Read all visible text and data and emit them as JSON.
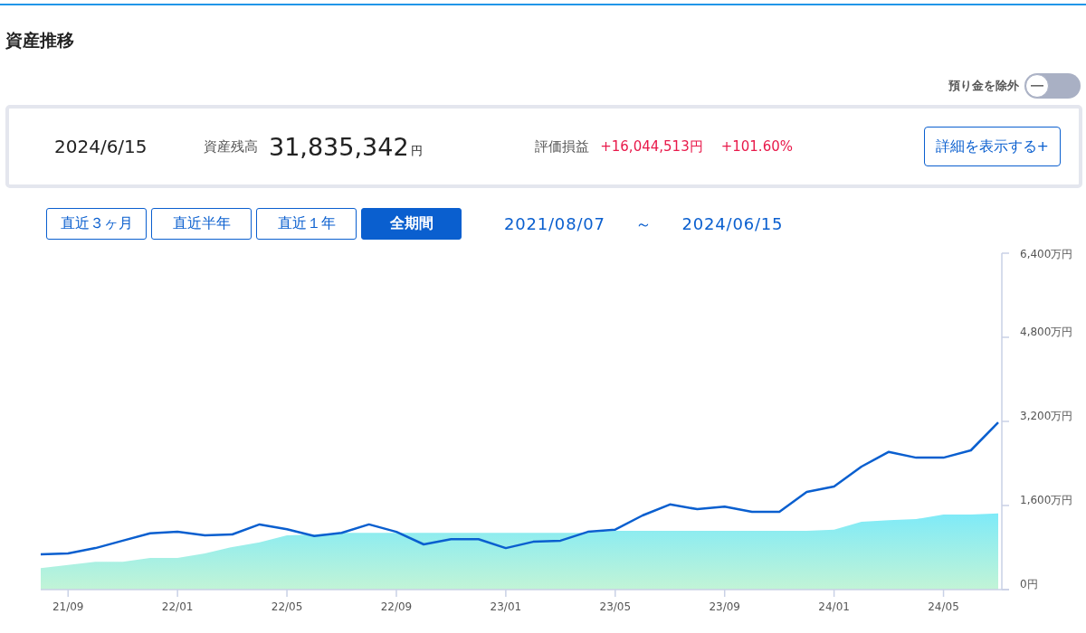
{
  "title": "資産推移",
  "toggle": {
    "label": "預り金を除外",
    "on": false
  },
  "summary": {
    "date": "2024/6/15",
    "balance_label": "資産残高",
    "balance": "31,835,342",
    "balance_unit": "円",
    "profit_label": "評価損益",
    "profit": "+16,044,513円",
    "profit_rate": "+101.60%",
    "detail_button": "詳細を表示する+"
  },
  "periods": [
    {
      "label": "直近３ヶ月",
      "selected": false
    },
    {
      "label": "直近半年",
      "selected": false
    },
    {
      "label": "直近１年",
      "selected": false
    },
    {
      "label": "全期間",
      "selected": true
    }
  ],
  "range": {
    "start": "2021/08/07",
    "separator": "～",
    "end": "2024/06/15"
  },
  "chart": {
    "chart_data": {
      "type": "line",
      "categories": [
        null,
        "21/09",
        null,
        null,
        null,
        "22/01",
        null,
        null,
        null,
        "22/05",
        null,
        null,
        null,
        "22/09",
        null,
        null,
        null,
        "23/01",
        null,
        null,
        null,
        "23/05",
        null,
        null,
        null,
        "23/09",
        null,
        null,
        null,
        "24/01",
        null,
        null,
        null,
        "24/05",
        null,
        null
      ],
      "series": [
        {
          "type": "area",
          "color": "#7eeaf8",
          "values": [
            410,
            470,
            530,
            530,
            600,
            600,
            690,
            810,
            900,
            1030,
            1050,
            1080,
            1080,
            1080,
            1080,
            1080,
            1080,
            1080,
            1080,
            1080,
            1080,
            1120,
            1120,
            1120,
            1120,
            1120,
            1120,
            1120,
            1120,
            1140,
            1290,
            1320,
            1340,
            1430,
            1430,
            1450
          ]
        },
        {
          "type": "line",
          "color": "#0a5fcf",
          "values": [
            670,
            690,
            790,
            930,
            1070,
            1100,
            1030,
            1050,
            1240,
            1150,
            1020,
            1080,
            1240,
            1100,
            860,
            960,
            960,
            790,
            910,
            930,
            1100,
            1140,
            1410,
            1620,
            1530,
            1580,
            1480,
            1480,
            1860,
            1960,
            2340,
            2620,
            2510,
            2510,
            2650,
            3180
          ]
        }
      ],
      "ylim": [
        0,
        6400
      ],
      "yticks": [
        {
          "value": 0,
          "label": "0円"
        },
        {
          "value": 1600,
          "label": "1,600万円"
        },
        {
          "value": 3200,
          "label": "3,200万円"
        },
        {
          "value": 4800,
          "label": "4,800万円"
        },
        {
          "value": 6400,
          "label": "6,400万円"
        }
      ]
    }
  }
}
